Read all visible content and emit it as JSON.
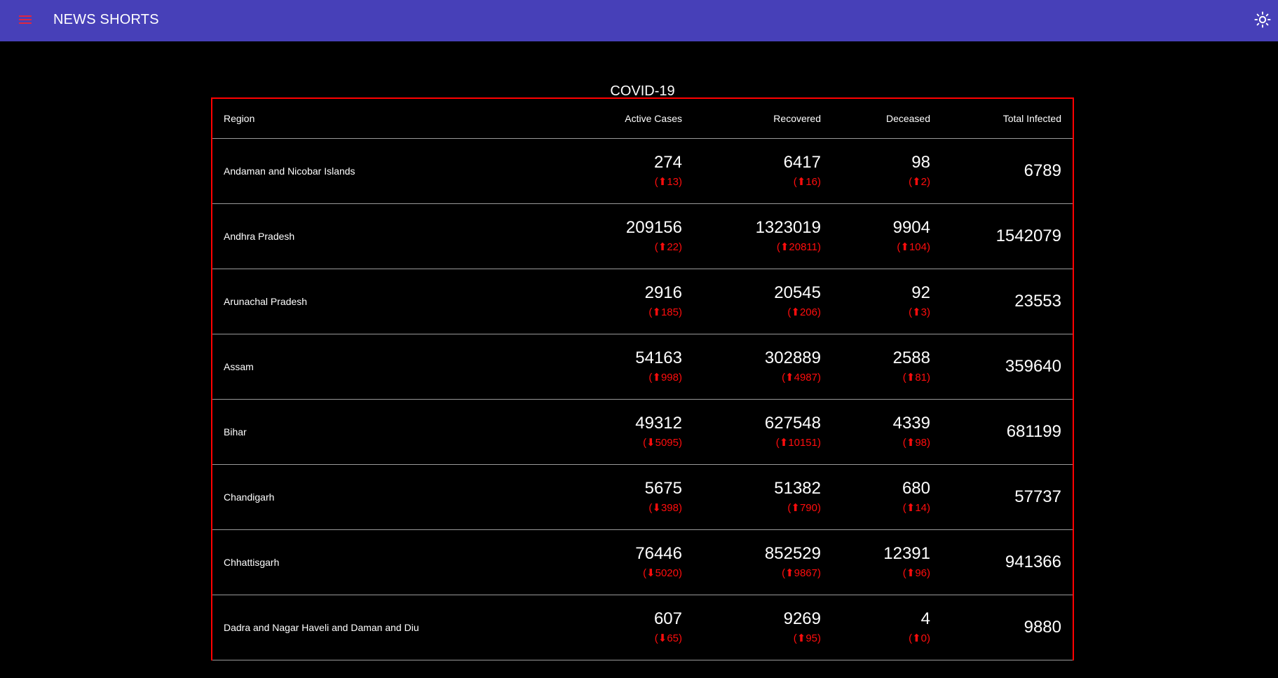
{
  "appbar": {
    "title": "NEWS SHORTS",
    "menu_icon": "hamburger-menu-icon",
    "theme_icon": "sun-icon",
    "background": "#4740b8",
    "menu_icon_color": "#e0263f"
  },
  "card": {
    "title": "COVID-19"
  },
  "table": {
    "headers": {
      "region": "Region",
      "active": "Active Cases",
      "recovered": "Recovered",
      "deceased": "Deceased",
      "total": "Total Infected"
    },
    "border_color": "#ff0000",
    "delta_color": "#ff0d0d",
    "rows": [
      {
        "region": "Andaman and Nicobar Islands",
        "active": "274",
        "active_delta": "(⬆13)",
        "recovered": "6417",
        "recovered_delta": "(⬆16)",
        "deceased": "98",
        "deceased_delta": "(⬆2)",
        "total": "6789"
      },
      {
        "region": "Andhra Pradesh",
        "active": "209156",
        "active_delta": "(⬆22)",
        "recovered": "1323019",
        "recovered_delta": "(⬆20811)",
        "deceased": "9904",
        "deceased_delta": "(⬆104)",
        "total": "1542079"
      },
      {
        "region": "Arunachal Pradesh",
        "active": "2916",
        "active_delta": "(⬆185)",
        "recovered": "20545",
        "recovered_delta": "(⬆206)",
        "deceased": "92",
        "deceased_delta": "(⬆3)",
        "total": "23553"
      },
      {
        "region": "Assam",
        "active": "54163",
        "active_delta": "(⬆998)",
        "recovered": "302889",
        "recovered_delta": "(⬆4987)",
        "deceased": "2588",
        "deceased_delta": "(⬆81)",
        "total": "359640"
      },
      {
        "region": "Bihar",
        "active": "49312",
        "active_delta": "(⬇5095)",
        "recovered": "627548",
        "recovered_delta": "(⬆10151)",
        "deceased": "4339",
        "deceased_delta": "(⬆98)",
        "total": "681199"
      },
      {
        "region": "Chandigarh",
        "active": "5675",
        "active_delta": "(⬇398)",
        "recovered": "51382",
        "recovered_delta": "(⬆790)",
        "deceased": "680",
        "deceased_delta": "(⬆14)",
        "total": "57737"
      },
      {
        "region": "Chhattisgarh",
        "active": "76446",
        "active_delta": "(⬇5020)",
        "recovered": "852529",
        "recovered_delta": "(⬆9867)",
        "deceased": "12391",
        "deceased_delta": "(⬆96)",
        "total": "941366"
      },
      {
        "region": "Dadra and Nagar Haveli and Daman and Diu",
        "active": "607",
        "active_delta": "(⬇65)",
        "recovered": "9269",
        "recovered_delta": "(⬆95)",
        "deceased": "4",
        "deceased_delta": "(⬆0)",
        "total": "9880"
      }
    ]
  }
}
